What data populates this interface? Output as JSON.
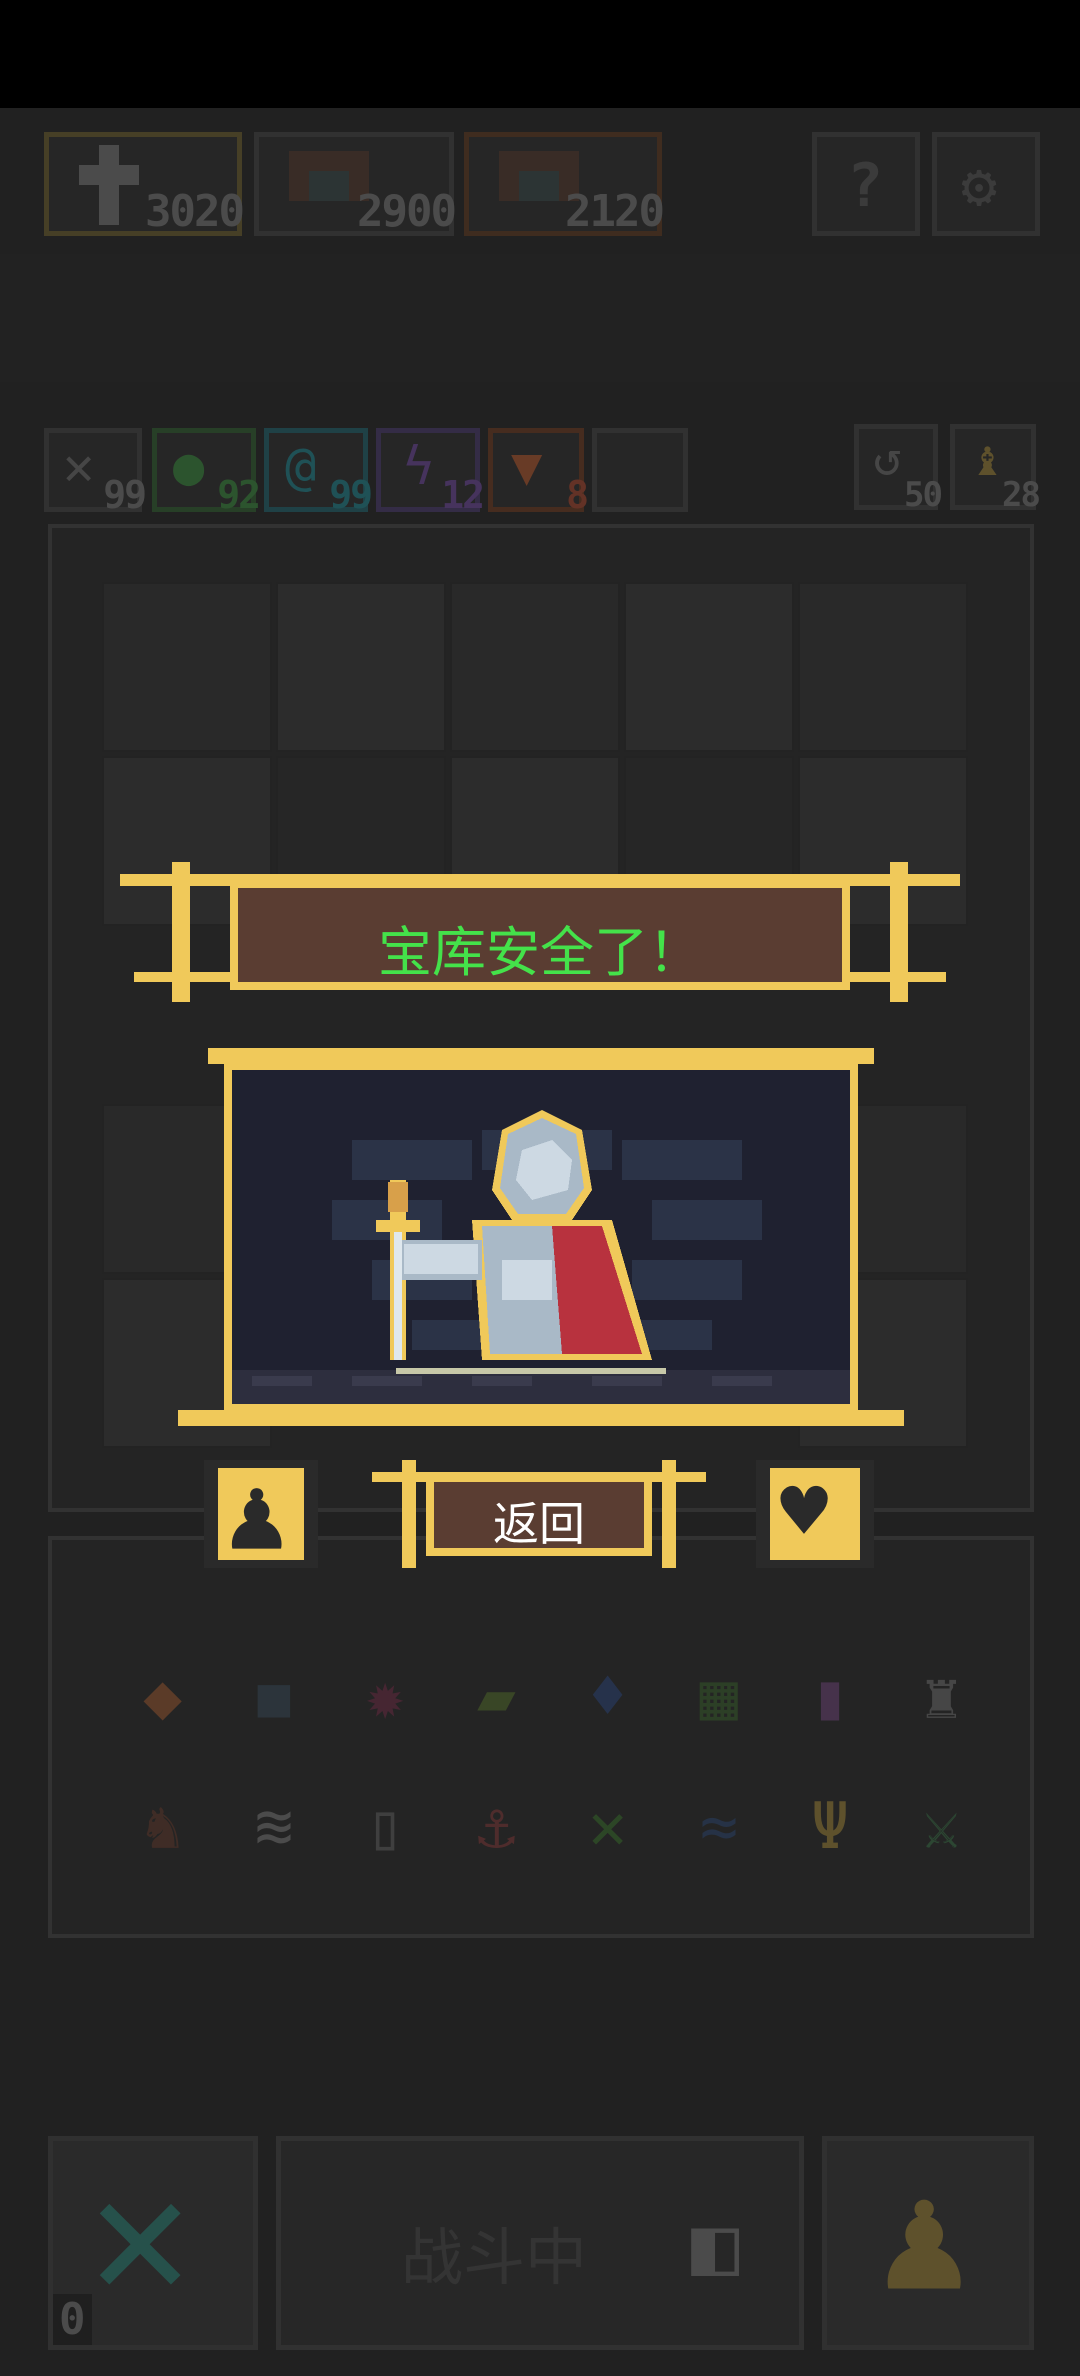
{
  "top_scores": {
    "items": [
      {
        "icon": "hero-icon",
        "value": "3020"
      },
      {
        "icon": "monster-icon",
        "value": "2900"
      },
      {
        "icon": "monster-icon",
        "value": "2120"
      }
    ]
  },
  "top_buttons": {
    "help_icon": "question-icon",
    "settings_icon": "gear-icon"
  },
  "resources": [
    {
      "icon": "sword-icon",
      "value": "99",
      "color": "#8a8a8a"
    },
    {
      "icon": "heal-icon",
      "value": "92",
      "color": "#4caf50"
    },
    {
      "icon": "spiral-icon",
      "value": "99",
      "color": "#2aa7b5"
    },
    {
      "icon": "lightning-icon",
      "value": "12",
      "color": "#8a5cc7"
    },
    {
      "icon": "shield-icon",
      "value": "8",
      "color": "#e0703a"
    }
  ],
  "right_counters": [
    {
      "icon": "turn-icon",
      "value": "50"
    },
    {
      "icon": "key-icon",
      "value": "28"
    }
  ],
  "dialog": {
    "title": "宝库安全了！",
    "return_label": "返回"
  },
  "bottom_bar": {
    "status_label": "战斗中",
    "corner_count": "0"
  },
  "colors": {
    "gold": "#f0c95a",
    "title_green": "#44e24a",
    "panel_brown": "#5a3d32",
    "scene_bg": "#1f2130"
  }
}
